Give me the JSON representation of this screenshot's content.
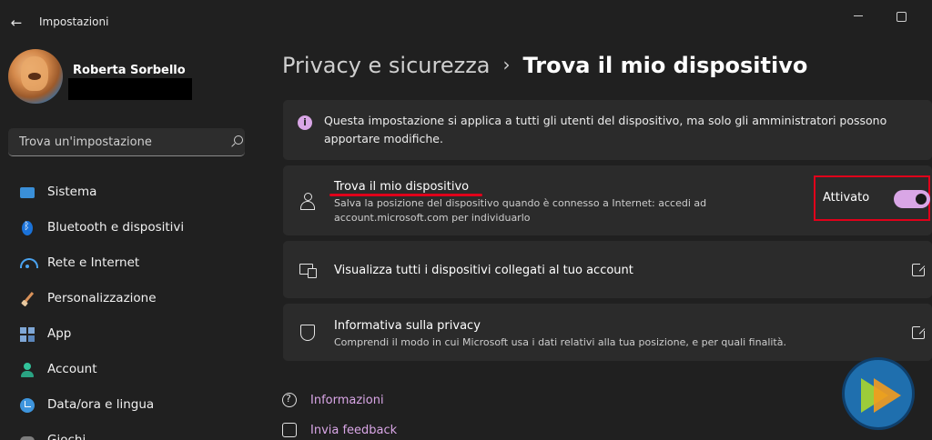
{
  "window": {
    "title": "Impostazioni"
  },
  "profile": {
    "name": "Roberta Sorbello"
  },
  "search": {
    "placeholder": "Trova un'impostazione"
  },
  "sidebar": {
    "items": [
      {
        "label": "Sistema",
        "icon": "system-icon"
      },
      {
        "label": "Bluetooth e dispositivi",
        "icon": "bluetooth-icon"
      },
      {
        "label": "Rete e Internet",
        "icon": "wifi-icon"
      },
      {
        "label": "Personalizzazione",
        "icon": "brush-icon"
      },
      {
        "label": "App",
        "icon": "apps-icon"
      },
      {
        "label": "Account",
        "icon": "account-icon"
      },
      {
        "label": "Data/ora e lingua",
        "icon": "time-language-icon"
      },
      {
        "label": "Giochi",
        "icon": "gaming-icon"
      }
    ]
  },
  "breadcrumb": {
    "parent": "Privacy e sicurezza",
    "separator": "›",
    "current": "Trova il mio dispositivo"
  },
  "info": {
    "text": "Questa impostazione si applica a tutti gli utenti del dispositivo, ma solo gli amministratori possono apportare modifiche."
  },
  "find_device": {
    "title": "Trova il mio dispositivo",
    "description": "Salva la posizione del dispositivo quando è connesso a Internet: accedi ad account.microsoft.com per individuarlo",
    "toggle_state_label": "Attivato",
    "toggle_on": true
  },
  "devices_link": {
    "label": "Visualizza tutti i dispositivi collegati al tuo account"
  },
  "privacy": {
    "title": "Informativa sulla privacy",
    "description": "Comprendi il modo in cui Microsoft usa i dati relativi alla tua posizione, e per quali finalità."
  },
  "footer_links": {
    "info": "Informazioni",
    "feedback": "Invia feedback"
  },
  "colors": {
    "background": "#202020",
    "card": "#2b2b2b",
    "accent": "#d9a6e6",
    "highlight": "#e0001a"
  }
}
